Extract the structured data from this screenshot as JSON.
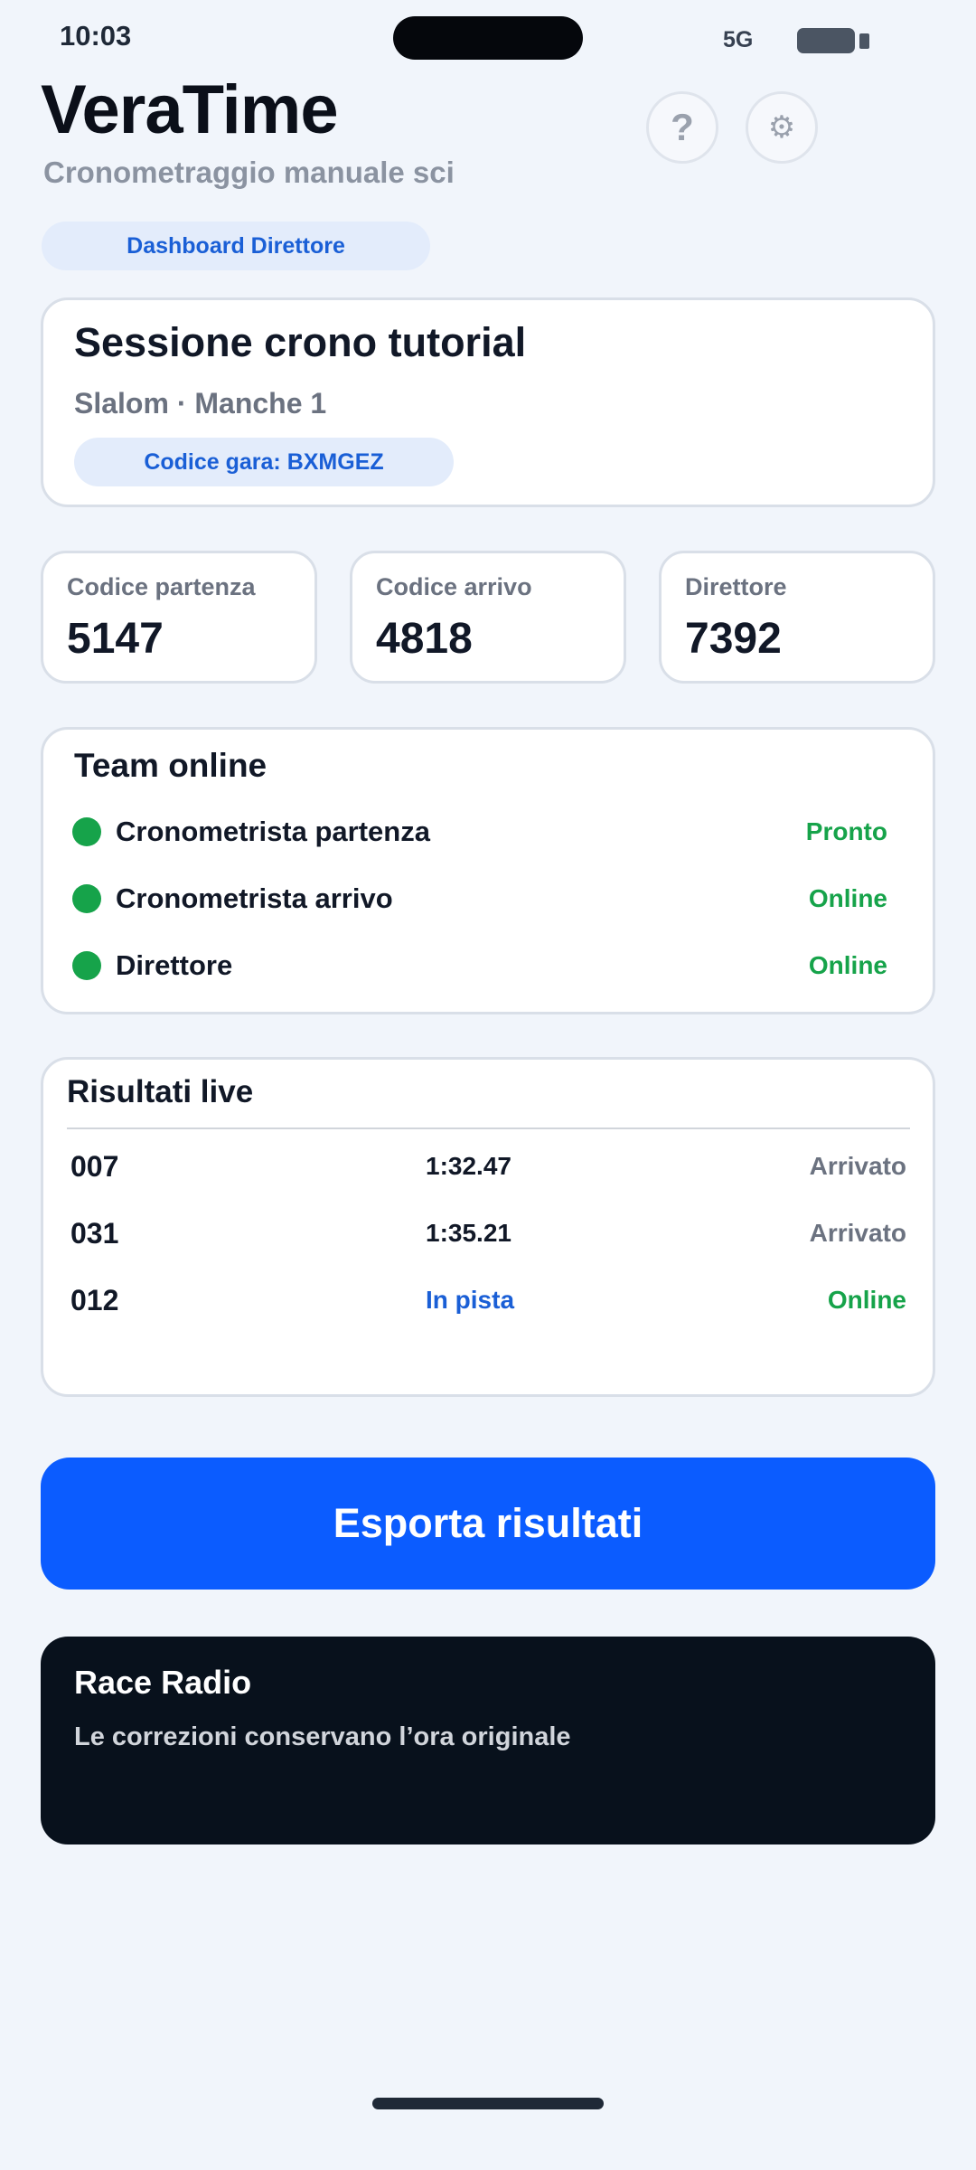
{
  "status_bar": {
    "time": "10:03",
    "network": "5G"
  },
  "header": {
    "title": "VeraTime",
    "subtitle": "Cronometraggio manuale sci",
    "help_icon": "?",
    "settings_icon": "⚙"
  },
  "dashboard_pill": "Dashboard Direttore",
  "session": {
    "title": "Sessione crono tutorial",
    "subtitle": "Slalom · Manche 1",
    "code_label": "Codice gara: BXMGEZ"
  },
  "stats": [
    {
      "label": "Codice partenza",
      "value": "5147"
    },
    {
      "label": "Codice arrivo",
      "value": "4818"
    },
    {
      "label": "Direttore",
      "value": "7392"
    }
  ],
  "team": {
    "title": "Team online",
    "members": [
      {
        "name": "Cronometrista partenza",
        "status": "Pronto"
      },
      {
        "name": "Cronometrista arrivo",
        "status": "Online"
      },
      {
        "name": "Direttore",
        "status": "Online"
      }
    ]
  },
  "results": {
    "title": "Risultati live",
    "rows": [
      {
        "bib": "007",
        "time": "1:32.47",
        "status": "Arrivato"
      },
      {
        "bib": "031",
        "time": "1:35.21",
        "status": "Arrivato"
      },
      {
        "bib": "012",
        "time": "In pista",
        "status": "Online"
      }
    ]
  },
  "export_button": "Esporta risultati",
  "radio": {
    "title": "Race Radio",
    "message": "Le correzioni conservano l’ora originale"
  },
  "colors": {
    "accent": "#0b5cff",
    "online_green": "#16a34a",
    "link_blue": "#1a5fd6",
    "radio_bg": "#08111c"
  }
}
